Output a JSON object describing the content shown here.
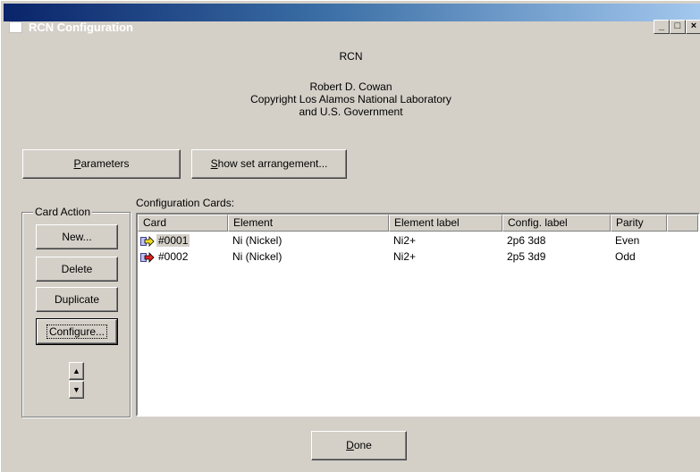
{
  "window": {
    "title": "RCN Configuration",
    "minimize": "_",
    "maximize": "□",
    "close": "×"
  },
  "about": {
    "app_name": "RCN",
    "author": "Robert D. Cowan",
    "copyright": "Copyright Los Alamos National Laboratory",
    "copyright2": "and U.S. Government"
  },
  "toolbar": {
    "parameters_label": "Parameters",
    "parameters_mnemonic": "P",
    "show_label": "Show set arrangement...",
    "show_mnemonic": "S"
  },
  "card_action": {
    "label": "Card Action",
    "new_label": "New...",
    "delete_label": "Delete",
    "duplicate_label": "Duplicate",
    "configure_label": "Configure...",
    "up_label": "▲",
    "down_label": "▼"
  },
  "cards": {
    "label": "Configuration Cards:",
    "columns": [
      "Card",
      "Element",
      "Element label",
      "Config. label",
      "Parity"
    ],
    "rows": [
      {
        "card": "#0001",
        "element": "Ni (Nickel)",
        "element_label": "Ni2+",
        "config_label": "2p6 3d8",
        "parity": "Even",
        "icon_color": "#f0e020"
      },
      {
        "card": "#0002",
        "element": "Ni (Nickel)",
        "element_label": "Ni2+",
        "config_label": "2p5 3d9",
        "parity": "Odd",
        "icon_color": "#e02020"
      }
    ]
  },
  "done_label": "Done"
}
